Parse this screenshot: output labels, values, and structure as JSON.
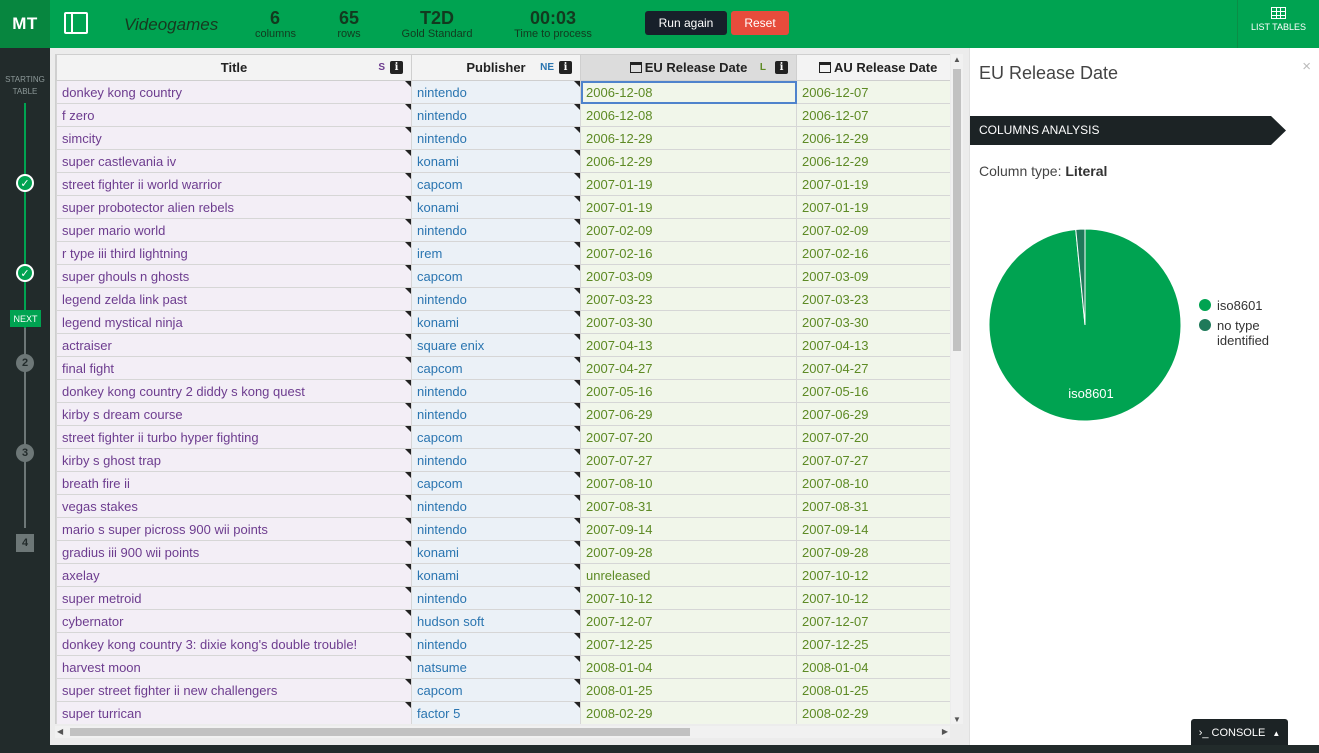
{
  "header": {
    "logo": "MT",
    "title": "Videogames",
    "stats": [
      {
        "value": "6",
        "label": "columns"
      },
      {
        "value": "65",
        "label": "rows"
      },
      {
        "value": "T2D",
        "label": "Gold Standard"
      },
      {
        "value": "00:03",
        "label": "Time to process"
      }
    ],
    "run_label": "Run again",
    "reset_label": "Reset",
    "list_tables_label": "LIST TABLES"
  },
  "steps": {
    "start_label_1": "STARTING",
    "start_label_2": "TABLE",
    "next_label": "NEXT",
    "step2": "2",
    "step3": "3",
    "step4": "4"
  },
  "table": {
    "columns": [
      {
        "name": "Title",
        "tag": "S",
        "tag_color": "#6d3c8f"
      },
      {
        "name": "Publisher",
        "tag": "NE",
        "tag_color": "#2a75b0"
      },
      {
        "name": "EU Release Date",
        "tag": "L",
        "tag_color": "#5d8a24"
      },
      {
        "name": "AU Release Date",
        "tag": "",
        "tag_color": "#5d8a24"
      }
    ],
    "rows": [
      [
        "donkey kong country",
        "nintendo",
        "2006-12-08",
        "2006-12-07"
      ],
      [
        "f zero",
        "nintendo",
        "2006-12-08",
        "2006-12-07"
      ],
      [
        "simcity",
        "nintendo",
        "2006-12-29",
        "2006-12-29"
      ],
      [
        "super castlevania iv",
        "konami",
        "2006-12-29",
        "2006-12-29"
      ],
      [
        "street fighter ii world warrior",
        "capcom",
        "2007-01-19",
        "2007-01-19"
      ],
      [
        "super probotector alien rebels",
        "konami",
        "2007-01-19",
        "2007-01-19"
      ],
      [
        "super mario world",
        "nintendo",
        "2007-02-09",
        "2007-02-09"
      ],
      [
        "r type iii third lightning",
        "irem",
        "2007-02-16",
        "2007-02-16"
      ],
      [
        "super ghouls n ghosts",
        "capcom",
        "2007-03-09",
        "2007-03-09"
      ],
      [
        "legend zelda link past",
        "nintendo",
        "2007-03-23",
        "2007-03-23"
      ],
      [
        "legend mystical ninja",
        "konami",
        "2007-03-30",
        "2007-03-30"
      ],
      [
        "actraiser",
        "square enix",
        "2007-04-13",
        "2007-04-13"
      ],
      [
        "final fight",
        "capcom",
        "2007-04-27",
        "2007-04-27"
      ],
      [
        "donkey kong country 2 diddy s kong quest",
        "nintendo",
        "2007-05-16",
        "2007-05-16"
      ],
      [
        "kirby s dream course",
        "nintendo",
        "2007-06-29",
        "2007-06-29"
      ],
      [
        "street fighter ii turbo hyper fighting",
        "capcom",
        "2007-07-20",
        "2007-07-20"
      ],
      [
        "kirby s ghost trap",
        "nintendo",
        "2007-07-27",
        "2007-07-27"
      ],
      [
        "breath fire ii",
        "capcom",
        "2007-08-10",
        "2007-08-10"
      ],
      [
        "vegas stakes",
        "nintendo",
        "2007-08-31",
        "2007-08-31"
      ],
      [
        "mario s super picross 900 wii points",
        "nintendo",
        "2007-09-14",
        "2007-09-14"
      ],
      [
        "gradius iii 900 wii points",
        "konami",
        "2007-09-28",
        "2007-09-28"
      ],
      [
        "axelay",
        "konami",
        "unreleased",
        "2007-10-12"
      ],
      [
        "super metroid",
        "nintendo",
        "2007-10-12",
        "2007-10-12"
      ],
      [
        "cybernator",
        "hudson soft",
        "2007-12-07",
        "2007-12-07"
      ],
      [
        "donkey kong country 3: dixie kong's double trouble!",
        "nintendo",
        "2007-12-25",
        "2007-12-25"
      ],
      [
        "harvest moon",
        "natsume",
        "2008-01-04",
        "2008-01-04"
      ],
      [
        "super street fighter ii new challengers",
        "capcom",
        "2008-01-25",
        "2008-01-25"
      ],
      [
        "super turrican",
        "factor 5",
        "2008-02-29",
        "2008-02-29"
      ]
    ]
  },
  "panel": {
    "title": "EU Release Date",
    "close": "×",
    "ribbon": "COLUMNS ANALYSIS",
    "coltype_label": "Column type:",
    "coltype_value": "Literal",
    "console_label": "CONSOLE"
  },
  "chart_data": {
    "type": "pie",
    "slices": [
      {
        "label": "iso8601",
        "value": 64,
        "color": "#00a351"
      },
      {
        "label": "no type identified",
        "value": 1,
        "color": "#1f7a5a"
      }
    ],
    "legend": [
      "iso8601",
      "no type identified"
    ],
    "slice_label": "iso8601"
  }
}
